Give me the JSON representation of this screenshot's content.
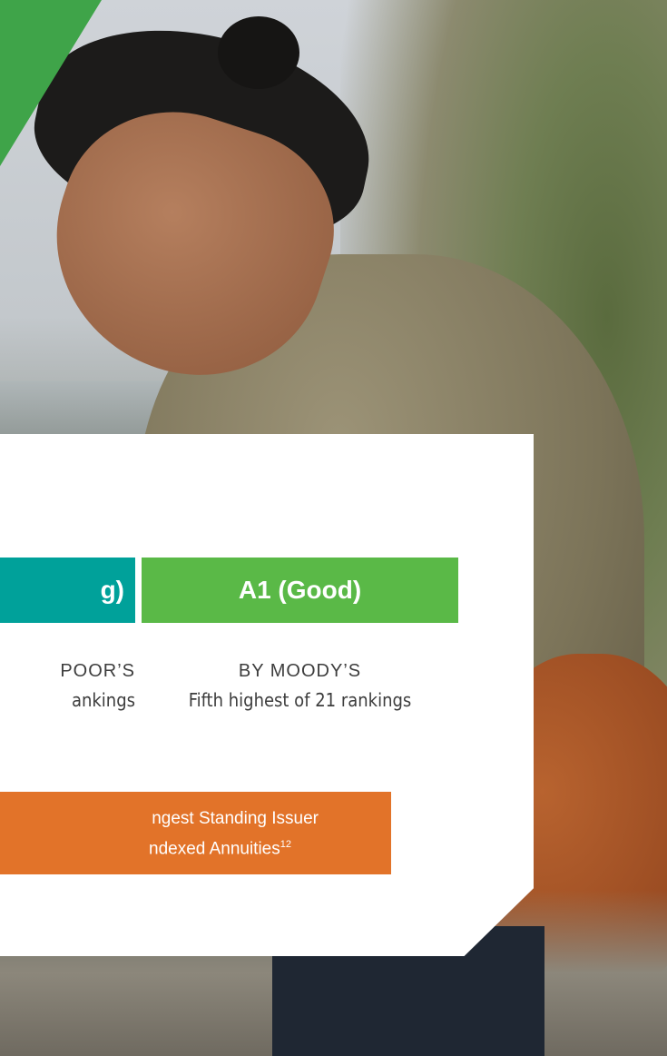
{
  "colors": {
    "corner": "#3fa449",
    "teal": "#00a19a",
    "green": "#5ab947",
    "orange": "#e27329"
  },
  "ratings": {
    "left": {
      "label": "g)",
      "agency": "POOR’S",
      "detail": "ankings"
    },
    "right": {
      "label": "A1 (Good)",
      "agency": "BY MOODY’S",
      "detail": "Fifth highest of 21 rankings"
    }
  },
  "banner": {
    "line1": "ngest Standing Issuer",
    "line2": "ndexed Annuities",
    "superscript": "12"
  }
}
